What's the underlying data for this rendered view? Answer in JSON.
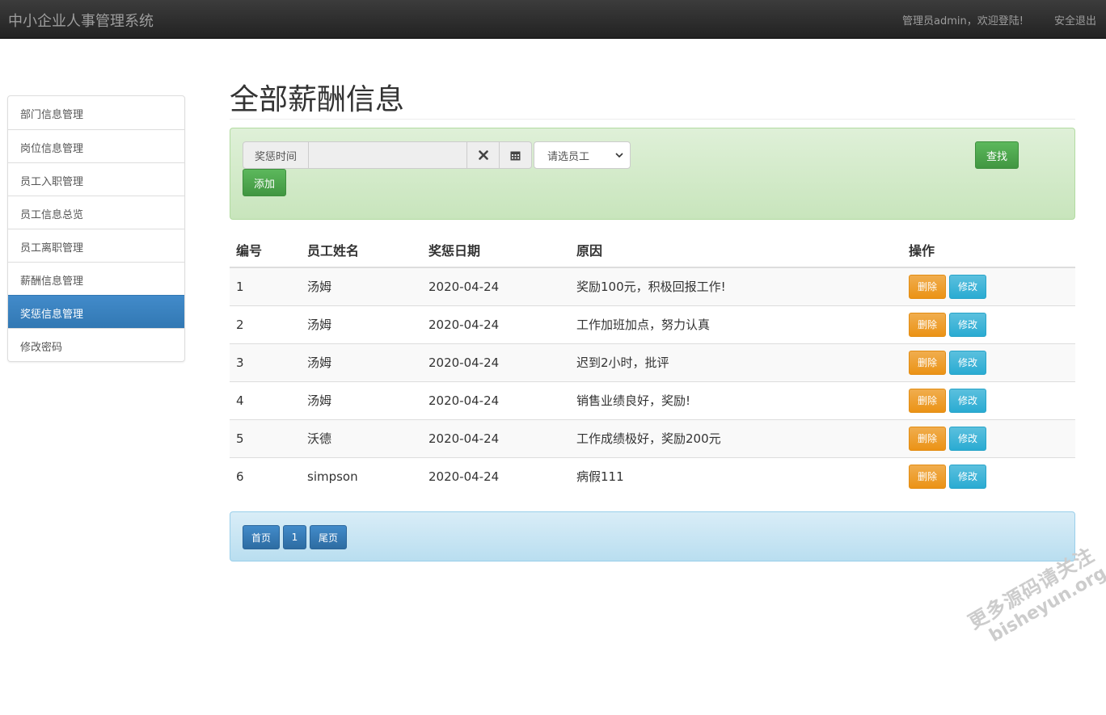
{
  "app": {
    "brand": "中小企业人事管理系统",
    "welcome": "管理员admin，欢迎登陆!",
    "logout": "安全退出"
  },
  "sidebar": {
    "items": [
      {
        "label": "部门信息管理",
        "active": false
      },
      {
        "label": "岗位信息管理",
        "active": false
      },
      {
        "label": "员工入职管理",
        "active": false
      },
      {
        "label": "员工信息总览",
        "active": false
      },
      {
        "label": "员工离职管理",
        "active": false
      },
      {
        "label": "薪酬信息管理",
        "active": false
      },
      {
        "label": "奖惩信息管理",
        "active": true
      },
      {
        "label": "修改密码",
        "active": false
      }
    ]
  },
  "page": {
    "title": "全部薪酬信息"
  },
  "search": {
    "time_label": "奖惩时间",
    "time_value": "",
    "employee_select": "请选员工",
    "find_label": "查找",
    "add_label": "添加"
  },
  "table": {
    "headers": [
      "编号",
      "员工姓名",
      "奖惩日期",
      "原因",
      "操作"
    ],
    "rows": [
      {
        "id": "1",
        "name": "汤姆",
        "date": "2020-04-24",
        "reason": "奖励100元，积极回报工作!"
      },
      {
        "id": "2",
        "name": "汤姆",
        "date": "2020-04-24",
        "reason": "工作加班加点，努力认真"
      },
      {
        "id": "3",
        "name": "汤姆",
        "date": "2020-04-24",
        "reason": "迟到2小时，批评"
      },
      {
        "id": "4",
        "name": "汤姆",
        "date": "2020-04-24",
        "reason": "销售业绩良好，奖励!"
      },
      {
        "id": "5",
        "name": "沃德",
        "date": "2020-04-24",
        "reason": "工作成绩极好，奖励200元"
      },
      {
        "id": "6",
        "name": "simpson",
        "date": "2020-04-24",
        "reason": "病假111"
      }
    ],
    "delete_label": "删除",
    "edit_label": "修改"
  },
  "pager": {
    "first": "首页",
    "current": "1",
    "last": "尾页"
  },
  "watermark": {
    "line1": "更多源码请关注",
    "line2": "bisheyun.org"
  }
}
